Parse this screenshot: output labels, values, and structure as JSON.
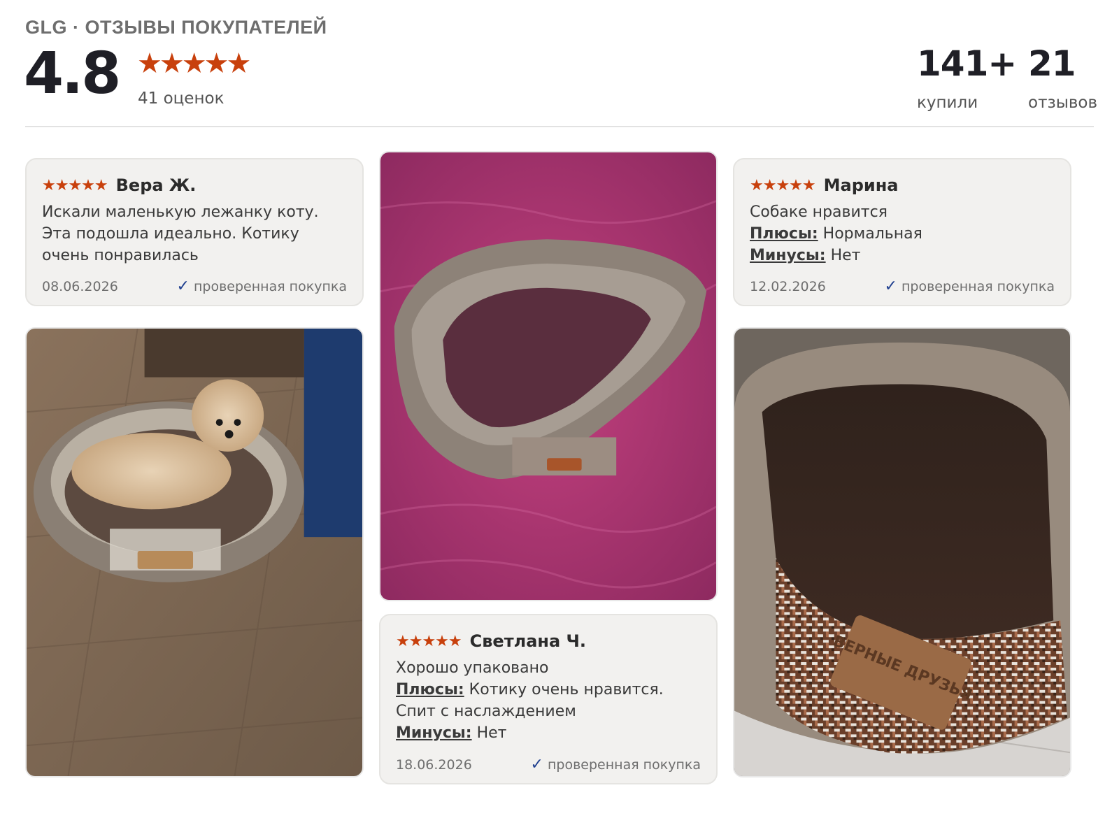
{
  "header": {
    "brand_title": "GLG · ОТЗЫВЫ ПОКУПАТЕЛЕЙ",
    "rating_value": "4.8",
    "rating_stars": "★★★★★",
    "rating_count": "41 оценок",
    "stats": [
      {
        "value": "141+",
        "label": "купили"
      },
      {
        "value": "21",
        "label": "отзывов"
      }
    ]
  },
  "reviews": [
    {
      "stars": "★★★★★",
      "author": "Вера Ж.",
      "text": "Искали маленькую лежанку коту. Эта подошла идеально. Котику очень понравилась",
      "date": "08.06.2026",
      "verified": "проверенная покупка"
    },
    {
      "stars": "★★★★★",
      "author": "Марина",
      "text": "Собаке нравится",
      "pros_label": "Плюсы:",
      "pros": "Нормальная",
      "cons_label": "Минусы:",
      "cons": "Нет",
      "date": "12.02.2026",
      "verified": "проверенная покупка"
    },
    {
      "stars": "★★★★★",
      "author": "Светлана Ч.",
      "text": "Хорошо упаковано",
      "pros_label": "Плюсы:",
      "pros": "Котику очень нравится. Спит с наслаждением",
      "cons_label": "Минусы:",
      "cons": "Нет",
      "date": "18.06.2026",
      "verified": "проверенная покупка"
    }
  ],
  "photos": {
    "bed_label_text": "ВЕРНЫЕ ДРУЗЬЯ"
  },
  "icons": {
    "star": "star-icon",
    "check": "check-icon"
  },
  "colors": {
    "star": "#c8400c",
    "check": "#1f3f8f",
    "card_bg": "#f2f1ef"
  }
}
